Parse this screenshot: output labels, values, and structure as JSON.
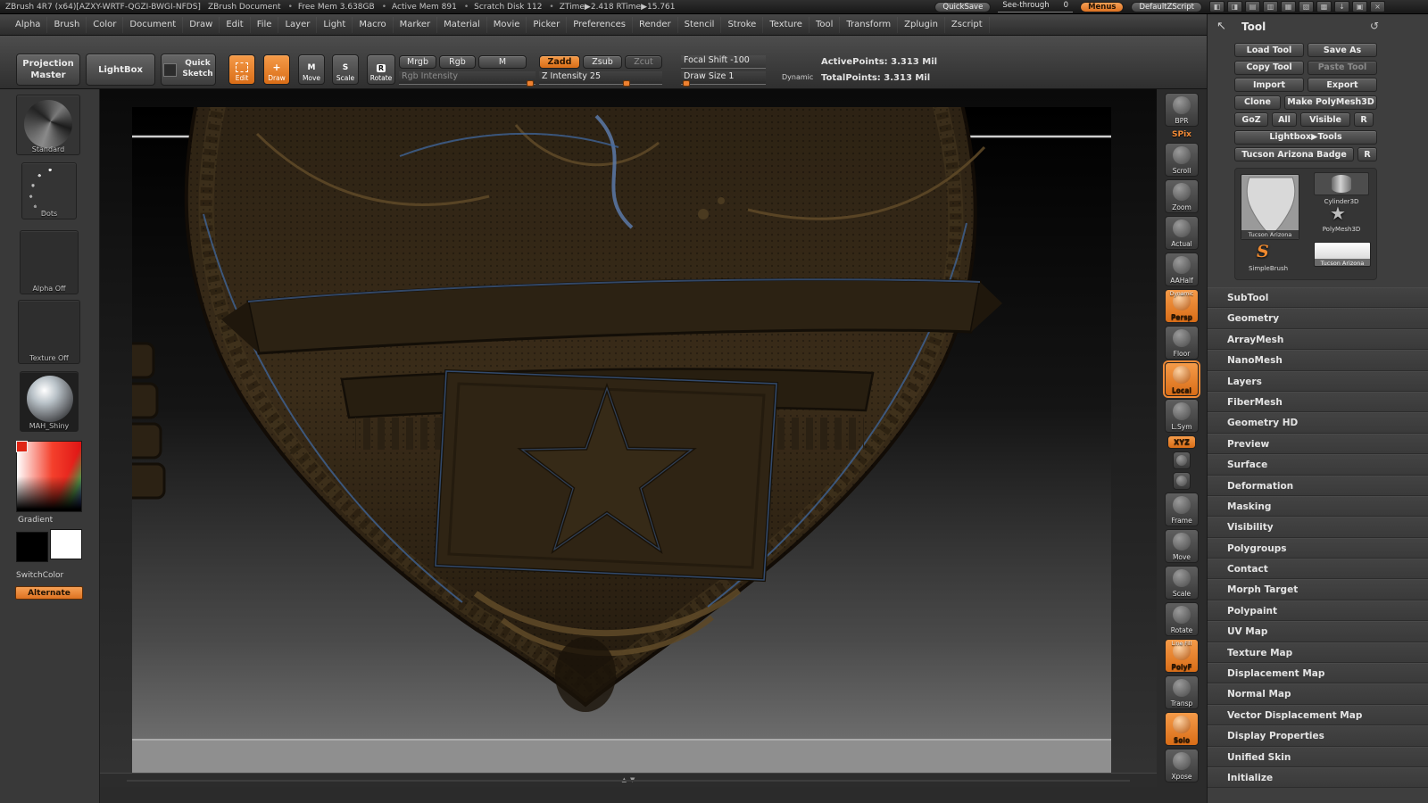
{
  "colors": {
    "accent": "#e8772e",
    "wireframe_blue": "#4a6fa8",
    "badge_bronze": "#342817",
    "canvas_gradient_top": "#000000",
    "canvas_gradient_bottom": "#787878"
  },
  "title_bar": {
    "app_title": "ZBrush 4R7 (x64)[AZXY-WRTF-QGZI-BWGI-NFDS]",
    "doc_title": "ZBrush Document",
    "stats": [
      "Free Mem 3.638GB",
      "Active Mem 891",
      "Scratch Disk 112",
      "ZTime▶2.418 RTime▶15.761"
    ],
    "quicksave": "QuickSave",
    "see_through_label": "See-through",
    "see_through_value": "0",
    "menus": "Menus",
    "default_zscript": "DefaultZScript",
    "icons": [
      {
        "name": "scroll-controls-icon",
        "glyph": "◧"
      },
      {
        "name": "zoom-controls-icon",
        "glyph": "◨"
      },
      {
        "name": "copy-document-icon",
        "glyph": "▤"
      },
      {
        "name": "paste-document-icon",
        "glyph": "▥"
      },
      {
        "name": "import-document-icon",
        "glyph": "▦"
      },
      {
        "name": "export-document-icon",
        "glyph": "▧"
      },
      {
        "name": "lock-icon",
        "glyph": "▩"
      },
      {
        "name": "minimize-icon",
        "glyph": "↓"
      },
      {
        "name": "fullscreen-icon",
        "glyph": "▣"
      },
      {
        "name": "close-icon",
        "glyph": "×"
      }
    ]
  },
  "menu_bar": {
    "items": [
      "Alpha",
      "Brush",
      "Color",
      "Document",
      "Draw",
      "Edit",
      "File",
      "Layer",
      "Light",
      "Macro",
      "Marker",
      "Material",
      "Movie",
      "Picker",
      "Preferences",
      "Render",
      "Stencil",
      "Stroke",
      "Texture",
      "Tool",
      "Transform",
      "Zplugin",
      "Zscript"
    ]
  },
  "shelf": {
    "projection_master": [
      "Projection",
      "Master"
    ],
    "lightbox": "LightBox",
    "quick_sketch": [
      "Quick",
      "Sketch"
    ],
    "edit": "Edit",
    "draw": "Draw",
    "move": "Move",
    "scale": "Scale",
    "rotate": "Rotate",
    "move_letter": "M",
    "scale_letter": "S",
    "rotate_letter": "R",
    "mrgb": "Mrgb",
    "rgb": "Rgb",
    "m": "M",
    "zadd": "Zadd",
    "zsub": "Zsub",
    "zcut": "Zcut",
    "rgb_intensity": "Rgb Intensity",
    "z_intensity": "Z Intensity 25",
    "focal_shift": "Focal Shift -100",
    "draw_size": "Draw Size 1",
    "dynamic": "Dynamic",
    "active_points": "ActivePoints: 3.313 Mil",
    "total_points": "TotalPoints: 3.313 Mil"
  },
  "left_tray": {
    "brush": "Standard",
    "stroke": "Dots",
    "alpha": "Alpha Off",
    "texture": "Texture Off",
    "material": "MAH_Shiny",
    "gradient": "Gradient",
    "switch_color": "SwitchColor",
    "alternate": "Alternate"
  },
  "canvas": {
    "scroll_up": "▲",
    "scroll_down": "▼"
  },
  "right_shelf": {
    "items": [
      {
        "label": "BPR",
        "cls": ""
      },
      {
        "label": "SPix",
        "cls": "rs-text orange-text"
      },
      {
        "label": "Scroll",
        "cls": ""
      },
      {
        "label": "Zoom",
        "cls": ""
      },
      {
        "label": "Actual",
        "cls": ""
      },
      {
        "label": "AAHalf",
        "cls": ""
      },
      {
        "label": "Persp",
        "cls": "orange",
        "top": "Dynamic"
      },
      {
        "label": "Floor",
        "cls": ""
      },
      {
        "label": "Local",
        "cls": "orange selected"
      },
      {
        "label": "L.Sym",
        "cls": ""
      },
      {
        "label": "XYZ",
        "cls": "chip"
      },
      {
        "label": "",
        "cls": "tiny"
      },
      {
        "label": "",
        "cls": "tiny"
      },
      {
        "label": "Frame",
        "cls": ""
      },
      {
        "label": "Move",
        "cls": ""
      },
      {
        "label": "Scale",
        "cls": ""
      },
      {
        "label": "Rotate",
        "cls": ""
      },
      {
        "label": "PolyF",
        "cls": "orange",
        "top": "Line Fill"
      },
      {
        "label": "Transp",
        "cls": ""
      },
      {
        "label": "Solo",
        "cls": "orange"
      },
      {
        "label": "Xpose",
        "cls": ""
      }
    ]
  },
  "tool_panel": {
    "title": "Tool",
    "buttons": {
      "load": "Load Tool",
      "save_as": "Save As",
      "copy": "Copy Tool",
      "paste": "Paste Tool",
      "import": "Import",
      "export": "Export",
      "clone": "Clone",
      "make_polymesh": "Make PolyMesh3D",
      "goz": "GoZ",
      "all": "All",
      "visible": "Visible",
      "r": "R",
      "lightbox_tools": "Lightbox▶Tools"
    },
    "current_tool": {
      "name": "Tucson Arizona Badge",
      "r": "R",
      "thumb_label": "Tucson Arizona"
    },
    "tools": {
      "cylinder": "Cylinder3D",
      "polymesh": "PolyMesh3D",
      "simplebrush": "SimpleBrush",
      "tucson": "Tucson Arizona"
    },
    "sections": [
      "SubTool",
      "Geometry",
      "ArrayMesh",
      "NanoMesh",
      "Layers",
      "FiberMesh",
      "Geometry HD",
      "Preview",
      "Surface",
      "Deformation",
      "Masking",
      "Visibility",
      "Polygroups",
      "Contact",
      "Morph Target",
      "Polypaint",
      "UV Map",
      "Texture Map",
      "Displacement Map",
      "Normal Map",
      "Vector Displacement Map",
      "Display Properties",
      "Unified Skin",
      "Initialize"
    ]
  }
}
